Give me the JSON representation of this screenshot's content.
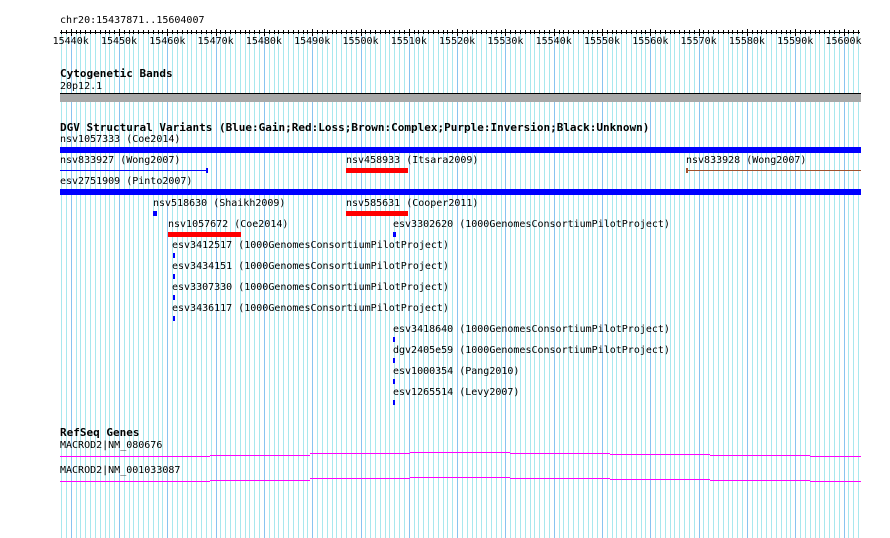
{
  "ruler": {
    "location": "chr20:15437871..15604007",
    "ticks": [
      "15440k",
      "15450k",
      "15460k",
      "15470k",
      "15480k",
      "15490k",
      "15500k",
      "15510k",
      "15520k",
      "15530k",
      "15540k",
      "15550k",
      "15560k",
      "15570k",
      "15580k",
      "15590k",
      "15600k"
    ]
  },
  "cytoband": {
    "title": "Cytogenetic Bands",
    "band": "20p12.1"
  },
  "dgv": {
    "title": "DGV Structural Variants (Blue:Gain;Red:Loss;Brown:Complex;Purple:Inversion;Black:Unknown)",
    "features": [
      "nsv1057333 (Coe2014)",
      "nsv833927 (Wong2007)",
      "nsv458933 (Itsara2009)",
      "nsv833928 (Wong2007)",
      "esv2751909 (Pinto2007)",
      "nsv518630 (Shaikh2009)",
      "nsv585631 (Cooper2011)",
      "nsv1057672 (Coe2014)",
      "esv3302620 (1000GenomesConsortiumPilotProject)",
      "esv3412517 (1000GenomesConsortiumPilotProject)",
      "esv3434151 (1000GenomesConsortiumPilotProject)",
      "esv3307330 (1000GenomesConsortiumPilotProject)",
      "esv3436117 (1000GenomesConsortiumPilotProject)",
      "esv3418640 (1000GenomesConsortiumPilotProject)",
      "dgv2405e59 (1000GenomesConsortiumPilotProject)",
      "esv1000354 (Pang2010)",
      "esv1265514 (Levy2007)"
    ]
  },
  "refseq": {
    "title": "RefSeq Genes",
    "genes": [
      "MACROD2|NM_080676",
      "MACROD2|NM_001033087"
    ]
  },
  "colors": {
    "gain": "#0000ff",
    "loss": "#ff0000",
    "complex": "#a0522d",
    "gene": "#ff00ff",
    "grid_minor": "#a8e8ee",
    "grid_major": "#88c4f0"
  }
}
